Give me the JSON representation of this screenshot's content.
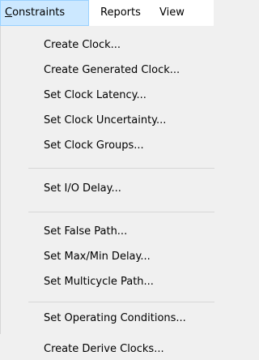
{
  "menubar": {
    "constraints_rest": "onstraints",
    "constraints_mnemonic": "C",
    "reports": "Reports",
    "view": "View"
  },
  "menu": {
    "items": [
      "Create Clock...",
      "Create Generated Clock...",
      "Set Clock Latency...",
      "Set Clock Uncertainty...",
      "Set Clock Groups...",
      "Set I/O Delay...",
      "Set False Path...",
      "Set Max/Min Delay...",
      "Set Multicycle Path...",
      "Set Operating Conditions...",
      "Create Derive Clocks..."
    ]
  }
}
